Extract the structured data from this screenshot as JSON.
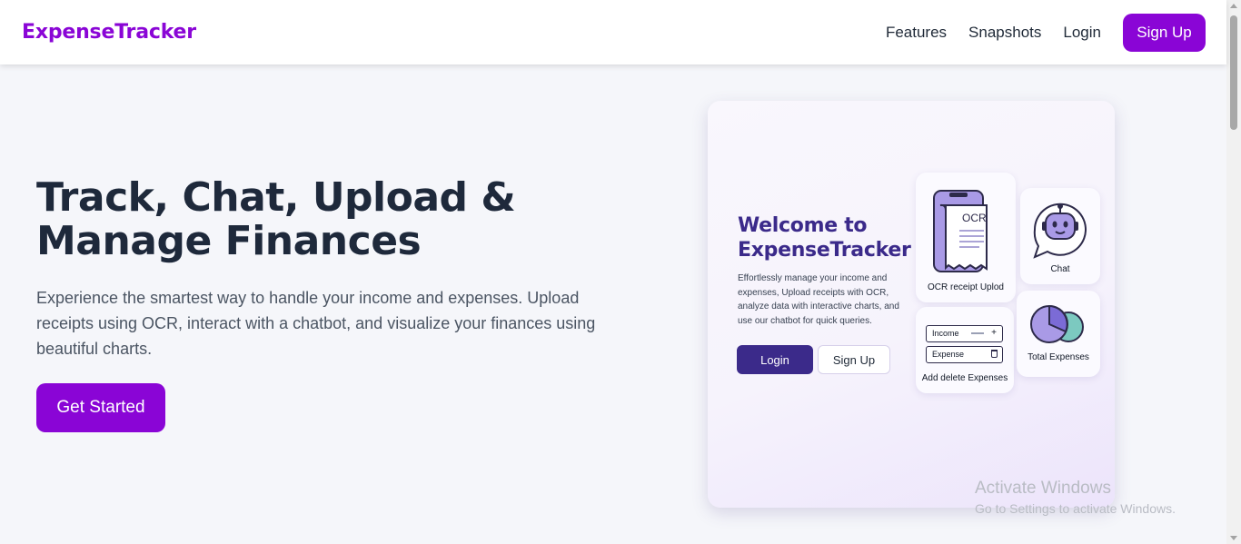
{
  "navbar": {
    "brand": "ExpenseTracker",
    "links": [
      "Features",
      "Snapshots",
      "Login"
    ],
    "signup_label": "Sign Up",
    "accent_color": "#8a05d6"
  },
  "hero": {
    "title": "Track, Chat, Upload & Manage Finances",
    "description": "Experience the smartest way to handle your income and expenses. Upload receipts using OCR, interact with a chatbot, and visualize your finances using beautiful charts.",
    "cta_label": "Get Started"
  },
  "card": {
    "title": "Welcome to ExpenseTracker",
    "description": "Effortlessly manage your income and expenses, Upload receipts with OCR, analyze data with interactive charts, and use our chatbot for quick queries.",
    "login_label": "Login",
    "signup_label": "Sign Up",
    "tiles": {
      "ocr": {
        "icon_text": "OCR",
        "label": "OCR receipt Uplod",
        "icon": "receipt-phone-icon"
      },
      "chat": {
        "label": "Chat",
        "icon": "robot-chat-icon"
      },
      "add": {
        "income_label": "Income",
        "expense_label": "Expense",
        "label": "Add delete Expenses"
      },
      "total": {
        "label": "Total Expenses",
        "icon": "pie-chart-icon"
      }
    }
  },
  "watermark": {
    "line1": "Activate Windows",
    "line2": "Go to Settings to activate Windows."
  }
}
